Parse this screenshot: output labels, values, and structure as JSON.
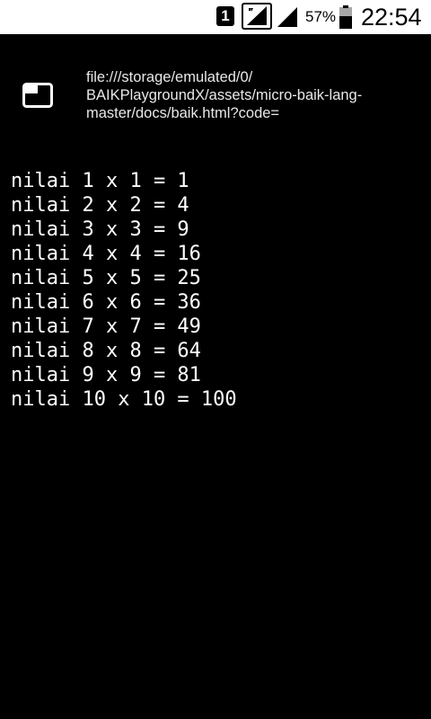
{
  "status_bar": {
    "sim_slot": "1",
    "battery_percent": "57%",
    "time": "22:54"
  },
  "browser": {
    "url": "file:///storage/emulated/0/BAIKPlaygroundX/assets/micro-baik-lang-master/docs/baik.html?code=",
    "url_lines": [
      "file:///storage/emulated/0/",
      "BAIKPlaygroundX/assets/micro-baik-lang-",
      "master/docs/baik.html?code="
    ]
  },
  "output": {
    "lines": [
      "nilai 1 x 1 = 1",
      "nilai 2 x 2 = 4",
      "nilai 3 x 3 = 9",
      "nilai 4 x 4 = 16",
      "nilai 5 x 5 = 25",
      "nilai 6 x 6 = 36",
      "nilai 7 x 7 = 49",
      "nilai 8 x 8 = 64",
      "nilai 9 x 9 = 81",
      "nilai 10 x 10 = 100"
    ]
  },
  "icons": {
    "sim": "sim-card-icon",
    "signal_primary": "cell-signal-icon",
    "signal_secondary": "cell-signal-icon",
    "battery": "battery-icon",
    "tab": "tab-window-icon"
  },
  "colors": {
    "background": "#000000",
    "status_bar": "#ffffff",
    "text": "#ffffff"
  }
}
